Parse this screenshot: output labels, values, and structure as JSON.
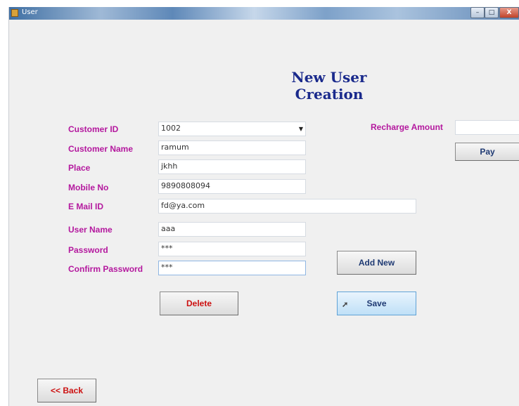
{
  "window": {
    "title": "User",
    "minimize_glyph": "–",
    "maximize_glyph": "□",
    "close_glyph": "X"
  },
  "heading": "New User Creation",
  "labels": {
    "customer_id": "Customer ID",
    "customer_name": "Customer Name",
    "place": "Place",
    "mobile_no": "Mobile No",
    "email_id": "E Mail ID",
    "user_name": "User Name",
    "password": "Password",
    "confirm_password": "Confirm Password",
    "recharge_amount": "Recharge Amount"
  },
  "fields": {
    "customer_id": "1002",
    "customer_name": "ramum",
    "place": "jkhh",
    "mobile_no": "9890808094",
    "email_id": "fd@ya.com",
    "user_name": "aaa",
    "password": "***",
    "confirm_password": "***",
    "recharge_amount": ""
  },
  "buttons": {
    "pay": "Pay",
    "add_new": "Add New",
    "delete": "Delete",
    "save": "Save",
    "back": "<< Back"
  },
  "icons": {
    "dropdown": "chevron-down-icon",
    "cursor": "mouse-pointer-icon"
  }
}
